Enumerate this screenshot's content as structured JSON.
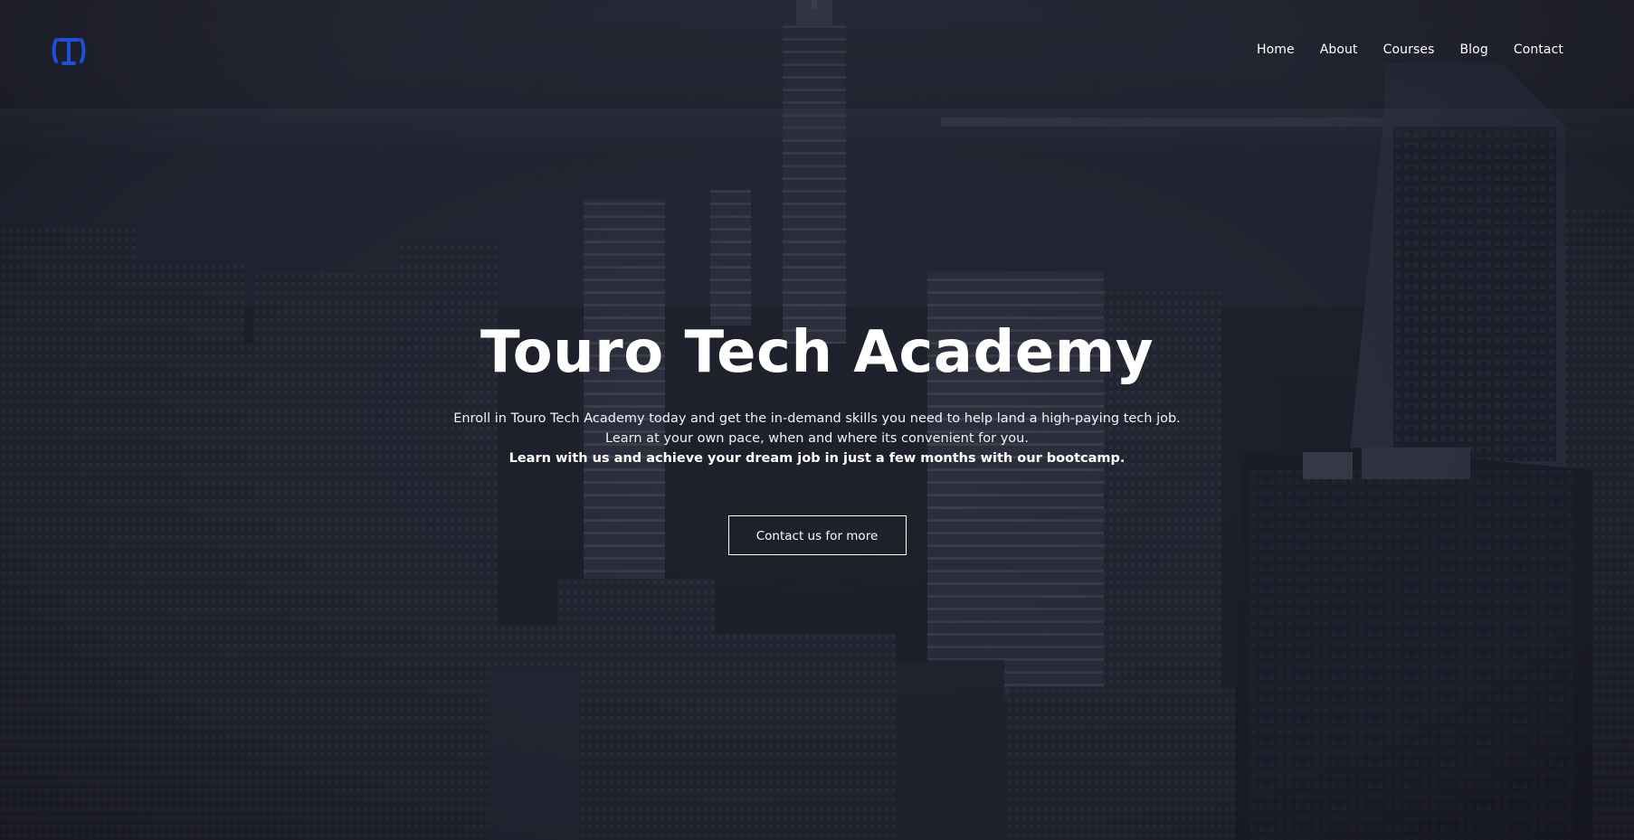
{
  "brand": {
    "logo_icon": "tta-monogram-logo-icon",
    "logo_color": "#1f4fd6"
  },
  "nav": {
    "items": [
      {
        "label": "Home"
      },
      {
        "label": "About"
      },
      {
        "label": "Courses"
      },
      {
        "label": "Blog"
      },
      {
        "label": "Contact"
      }
    ]
  },
  "hero": {
    "title": "Touro Tech Academy",
    "line1": "Enroll in Touro Tech Academy today and get the in-demand skills you need to help land a high-paying tech job.",
    "line2": "Learn at your own pace, when and where its convenient for you.",
    "line3": "Learn with us and achieve your dream job in just a few months with our bootcamp.",
    "cta_label": "Contact us for more"
  },
  "colors": {
    "overlay": "#22242f",
    "text": "#ffffff",
    "accent": "#1f4fd6"
  }
}
